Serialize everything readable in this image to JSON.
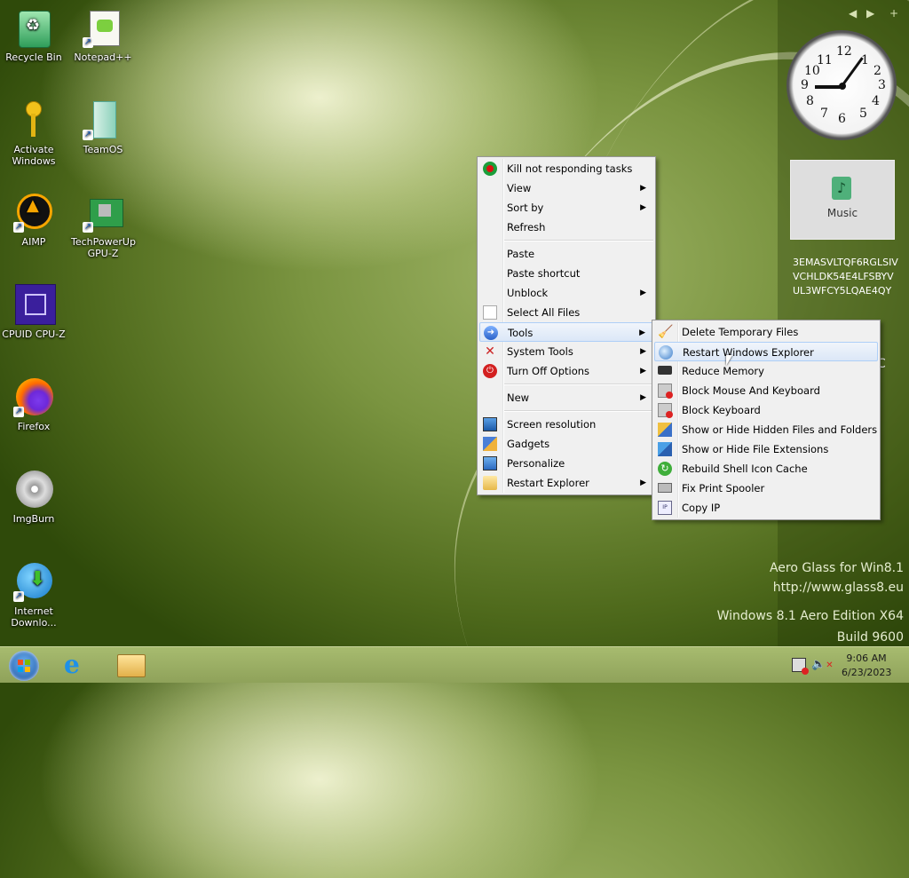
{
  "desktop": {
    "icons": [
      {
        "label": "Recycle Bin",
        "icon": "recycle-bin-icon"
      },
      {
        "label": "Notepad++",
        "icon": "notepad-plus-plus-icon"
      },
      {
        "label": "Activate Windows",
        "icon": "key-icon"
      },
      {
        "label": "TeamOS",
        "icon": "teamos-icon"
      },
      {
        "label": "AIMP",
        "icon": "aimp-icon"
      },
      {
        "label": "TechPowerUp GPU-Z",
        "icon": "gpu-z-icon"
      },
      {
        "label": "CPUID CPU-Z",
        "icon": "cpu-z-icon"
      },
      {
        "label": "Firefox",
        "icon": "firefox-icon"
      },
      {
        "label": "ImgBurn",
        "icon": "imgburn-icon"
      },
      {
        "label": "Internet Downlo...",
        "icon": "internet-download-manager-icon"
      }
    ]
  },
  "gadgets": {
    "music_label": "Music",
    "key_text": "3EMASVLTQF6RGLSIVVCHLDK54E4LFSBYVUL3WFCY5LQAE4QY",
    "weather_partial": "C",
    "clock_time": "9:06"
  },
  "watermark": {
    "line1": "Aero Glass for Win8.1",
    "line2": "http://www.glass8.eu",
    "line3": "Windows 8.1 Aero Edition X64",
    "line4": "Build 9600"
  },
  "taskbar": {
    "time": "9:06 AM",
    "date": "6/23/2023"
  },
  "context_menu": {
    "items": [
      {
        "label": "Kill not responding tasks",
        "icon": "stop-icon",
        "submenu": false
      },
      {
        "label": "View",
        "submenu": true
      },
      {
        "label": "Sort by",
        "submenu": true
      },
      {
        "label": "Refresh",
        "submenu": false
      },
      {
        "label": "Paste",
        "submenu": false
      },
      {
        "label": "Paste shortcut",
        "submenu": false
      },
      {
        "label": "Unblock",
        "submenu": true
      },
      {
        "label": "Select All Files",
        "icon": "file-icon",
        "submenu": false
      },
      {
        "label": "Tools",
        "icon": "tools-arrow-icon",
        "submenu": true
      },
      {
        "label": "System Tools",
        "icon": "wrench-icon",
        "submenu": true
      },
      {
        "label": "Turn Off Options",
        "icon": "power-icon",
        "submenu": true
      },
      {
        "label": "New",
        "submenu": true
      },
      {
        "label": "Screen resolution",
        "icon": "monitor-icon",
        "submenu": false
      },
      {
        "label": "Gadgets",
        "icon": "gadgets-icon",
        "submenu": false
      },
      {
        "label": "Personalize",
        "icon": "personalize-icon",
        "submenu": false
      },
      {
        "label": "Restart Explorer",
        "icon": "folder-icon",
        "submenu": true
      }
    ]
  },
  "tools_submenu": {
    "items": [
      {
        "label": "Delete Temporary Files",
        "icon": "broom-icon"
      },
      {
        "label": "Restart Windows Explorer",
        "icon": "globe-icon"
      },
      {
        "label": "Reduce Memory",
        "icon": "memory-icon"
      },
      {
        "label": "Block Mouse And Keyboard",
        "icon": "keyboard-block-icon"
      },
      {
        "label": "Block Keyboard",
        "icon": "keyboard-icon"
      },
      {
        "label": "Show or Hide Hidden Files and Folders",
        "icon": "show-hide-icon"
      },
      {
        "label": "Show or Hide File Extensions",
        "icon": "extensions-icon"
      },
      {
        "label": "Rebuild Shell Icon Cache",
        "icon": "refresh-icon"
      },
      {
        "label": "Fix Print Spooler",
        "icon": "printer-icon"
      },
      {
        "label": "Copy IP",
        "icon": "ip-icon"
      }
    ]
  }
}
